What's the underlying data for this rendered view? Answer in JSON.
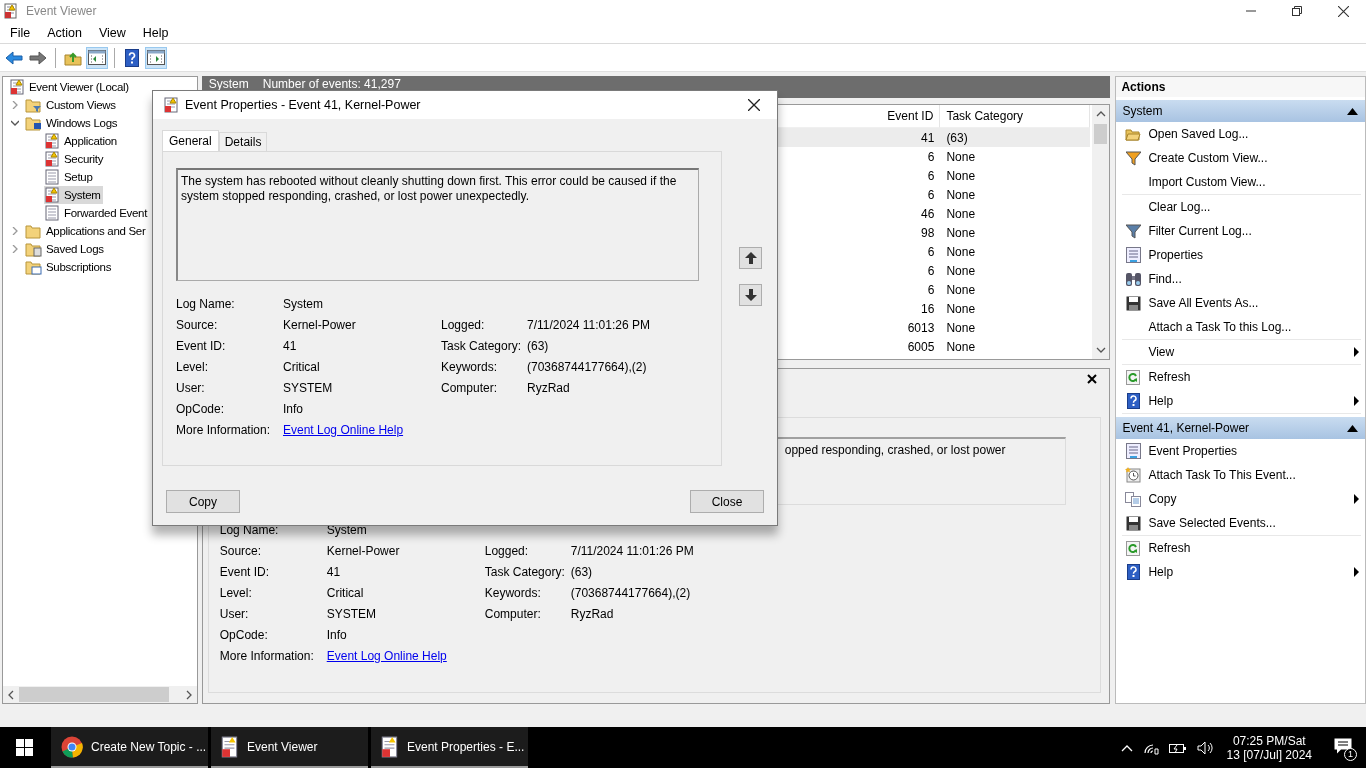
{
  "window": {
    "title": "Event Viewer"
  },
  "menu": [
    "File",
    "Action",
    "View",
    "Help"
  ],
  "toolbar": [
    {
      "kind": "back",
      "on": false
    },
    {
      "kind": "forward",
      "on": false
    },
    {
      "kind": "up",
      "on": false
    },
    {
      "kind": "console-tree",
      "on": true
    },
    {
      "kind": "help",
      "on": false
    },
    {
      "kind": "action-pane",
      "on": true
    }
  ],
  "tree": {
    "label": "Event Viewer (Local)",
    "kind": "viewer",
    "selected": false,
    "children": [
      {
        "label": "Custom Views",
        "kind": "folder-filter",
        "expanded": false,
        "selected": false
      },
      {
        "label": "Windows Logs",
        "kind": "folder-logs",
        "expanded": true,
        "selected": false,
        "children": [
          {
            "label": "Application",
            "kind": "log-alert",
            "selected": false
          },
          {
            "label": "Security",
            "kind": "log-alert",
            "selected": false
          },
          {
            "label": "Setup",
            "kind": "log",
            "selected": false
          },
          {
            "label": "System",
            "kind": "log-alert",
            "selected": true
          },
          {
            "label": "Forwarded Event",
            "kind": "log",
            "selected": false
          }
        ]
      },
      {
        "label": "Applications and Ser",
        "kind": "folder",
        "expanded": false,
        "selected": false
      },
      {
        "label": "Saved Logs",
        "kind": "folder-saved",
        "expanded": false,
        "selected": false
      },
      {
        "label": "Subscriptions",
        "kind": "folder-subs",
        "selected": false
      }
    ]
  },
  "log": {
    "title": "System",
    "count": "Number of events: 41,297",
    "columns": [
      "Event ID",
      "Task Category"
    ],
    "rows": [
      {
        "event_id": "41",
        "task_category": "(63)",
        "selected": true
      },
      {
        "event_id": "6",
        "task_category": "None",
        "selected": false
      },
      {
        "event_id": "6",
        "task_category": "None",
        "selected": false
      },
      {
        "event_id": "6",
        "task_category": "None",
        "selected": false
      },
      {
        "event_id": "46",
        "task_category": "None",
        "selected": false
      },
      {
        "event_id": "98",
        "task_category": "None",
        "selected": false
      },
      {
        "event_id": "6",
        "task_category": "None",
        "selected": false
      },
      {
        "event_id": "6",
        "task_category": "None",
        "selected": false
      },
      {
        "event_id": "6",
        "task_category": "None",
        "selected": false
      },
      {
        "event_id": "16",
        "task_category": "None",
        "selected": false
      },
      {
        "event_id": "6013",
        "task_category": "None",
        "selected": false
      },
      {
        "event_id": "6005",
        "task_category": "None",
        "selected": false
      }
    ]
  },
  "preview": {
    "message": "opped responding, crashed, or lost power",
    "fields_left": [
      {
        "label": "Log Name:",
        "value": "System",
        "kind": "text"
      },
      {
        "label": "Source:",
        "value": "Kernel-Power",
        "kind": "text"
      },
      {
        "label": "Event ID:",
        "value": "41",
        "kind": "text"
      },
      {
        "label": "Level:",
        "value": "Critical",
        "kind": "text"
      },
      {
        "label": "User:",
        "value": "SYSTEM",
        "kind": "text"
      },
      {
        "label": "OpCode:",
        "value": "Info",
        "kind": "text"
      },
      {
        "label": "More Information:",
        "value": "Event Log Online Help",
        "kind": "link"
      }
    ],
    "fields_right": [
      {
        "label": "Logged:",
        "value": "7/11/2024 11:01:26 PM"
      },
      {
        "label": "Task Category:",
        "value": "(63)"
      },
      {
        "label": "Keywords:",
        "value": "(70368744177664),(2)"
      },
      {
        "label": "Computer:",
        "value": "RyzRad"
      }
    ]
  },
  "actions": {
    "title": "Actions",
    "sections": [
      {
        "title": "System",
        "expanded": true,
        "groups": [
          [
            {
              "label": "Open Saved Log...",
              "kind": "open",
              "submenu": false
            },
            {
              "label": "Create Custom View...",
              "kind": "filter-orange",
              "submenu": false
            },
            {
              "label": "Import Custom View...",
              "kind": "plain",
              "submenu": false
            }
          ],
          [
            {
              "label": "Clear Log...",
              "kind": "plain",
              "submenu": false
            },
            {
              "label": "Filter Current Log...",
              "kind": "filter",
              "submenu": false
            },
            {
              "label": "Properties",
              "kind": "properties",
              "submenu": false
            },
            {
              "label": "Find...",
              "kind": "find",
              "submenu": false
            },
            {
              "label": "Save All Events As...",
              "kind": "save",
              "submenu": false
            },
            {
              "label": "Attach a Task To this Log...",
              "kind": "plain",
              "submenu": false
            }
          ],
          [
            {
              "label": "View",
              "kind": "plain",
              "submenu": true
            }
          ],
          [
            {
              "label": "Refresh",
              "kind": "refresh",
              "submenu": false
            },
            {
              "label": "Help",
              "kind": "help",
              "submenu": true
            }
          ]
        ]
      },
      {
        "title": "Event 41, Kernel-Power",
        "expanded": true,
        "groups": [
          [
            {
              "label": "Event Properties",
              "kind": "properties",
              "submenu": false
            },
            {
              "label": "Attach Task To This Event...",
              "kind": "attach-task",
              "submenu": false
            },
            {
              "label": "Copy",
              "kind": "copy",
              "submenu": true
            },
            {
              "label": "Save Selected Events...",
              "kind": "save",
              "submenu": false
            }
          ],
          [
            {
              "label": "Refresh",
              "kind": "refresh",
              "submenu": false
            },
            {
              "label": "Help",
              "kind": "help",
              "submenu": true
            }
          ]
        ]
      }
    ]
  },
  "dialog": {
    "title": "Event Properties - Event 41, Kernel-Power",
    "tabs": [
      {
        "label": "General",
        "selected": true
      },
      {
        "label": "Details",
        "selected": false
      }
    ],
    "message": "The system has rebooted without cleanly shutting down first. This error could be caused if the system stopped responding, crashed, or lost power unexpectedly.",
    "fields_left": [
      {
        "label": "Log Name:",
        "value": "System",
        "kind": "text"
      },
      {
        "label": "Source:",
        "value": "Kernel-Power",
        "kind": "text"
      },
      {
        "label": "Event ID:",
        "value": "41",
        "kind": "text"
      },
      {
        "label": "Level:",
        "value": "Critical",
        "kind": "text"
      },
      {
        "label": "User:",
        "value": "SYSTEM",
        "kind": "text"
      },
      {
        "label": "OpCode:",
        "value": "Info",
        "kind": "text"
      },
      {
        "label": "More Information:",
        "value": "Event Log Online Help",
        "kind": "link"
      }
    ],
    "fields_right": [
      {
        "label": "Logged:",
        "value": "7/11/2024 11:01:26 PM"
      },
      {
        "label": "Task Category:",
        "value": "(63)"
      },
      {
        "label": "Keywords:",
        "value": "(70368744177664),(2)"
      },
      {
        "label": "Computer:",
        "value": "RyzRad"
      }
    ],
    "buttons": [
      "Copy",
      "Close"
    ]
  },
  "taskbar": {
    "apps": [
      {
        "label": "Create New Topic - ...",
        "kind": "browser",
        "running": true
      },
      {
        "label": "Event Viewer",
        "kind": "viewer",
        "running": true
      },
      {
        "label": "Event Properties - E...",
        "kind": "viewer",
        "running": true
      }
    ],
    "clock_time": "07:25 PM/Sat",
    "clock_date": "13 [07/Jul] 2024",
    "notification_count": "1"
  }
}
